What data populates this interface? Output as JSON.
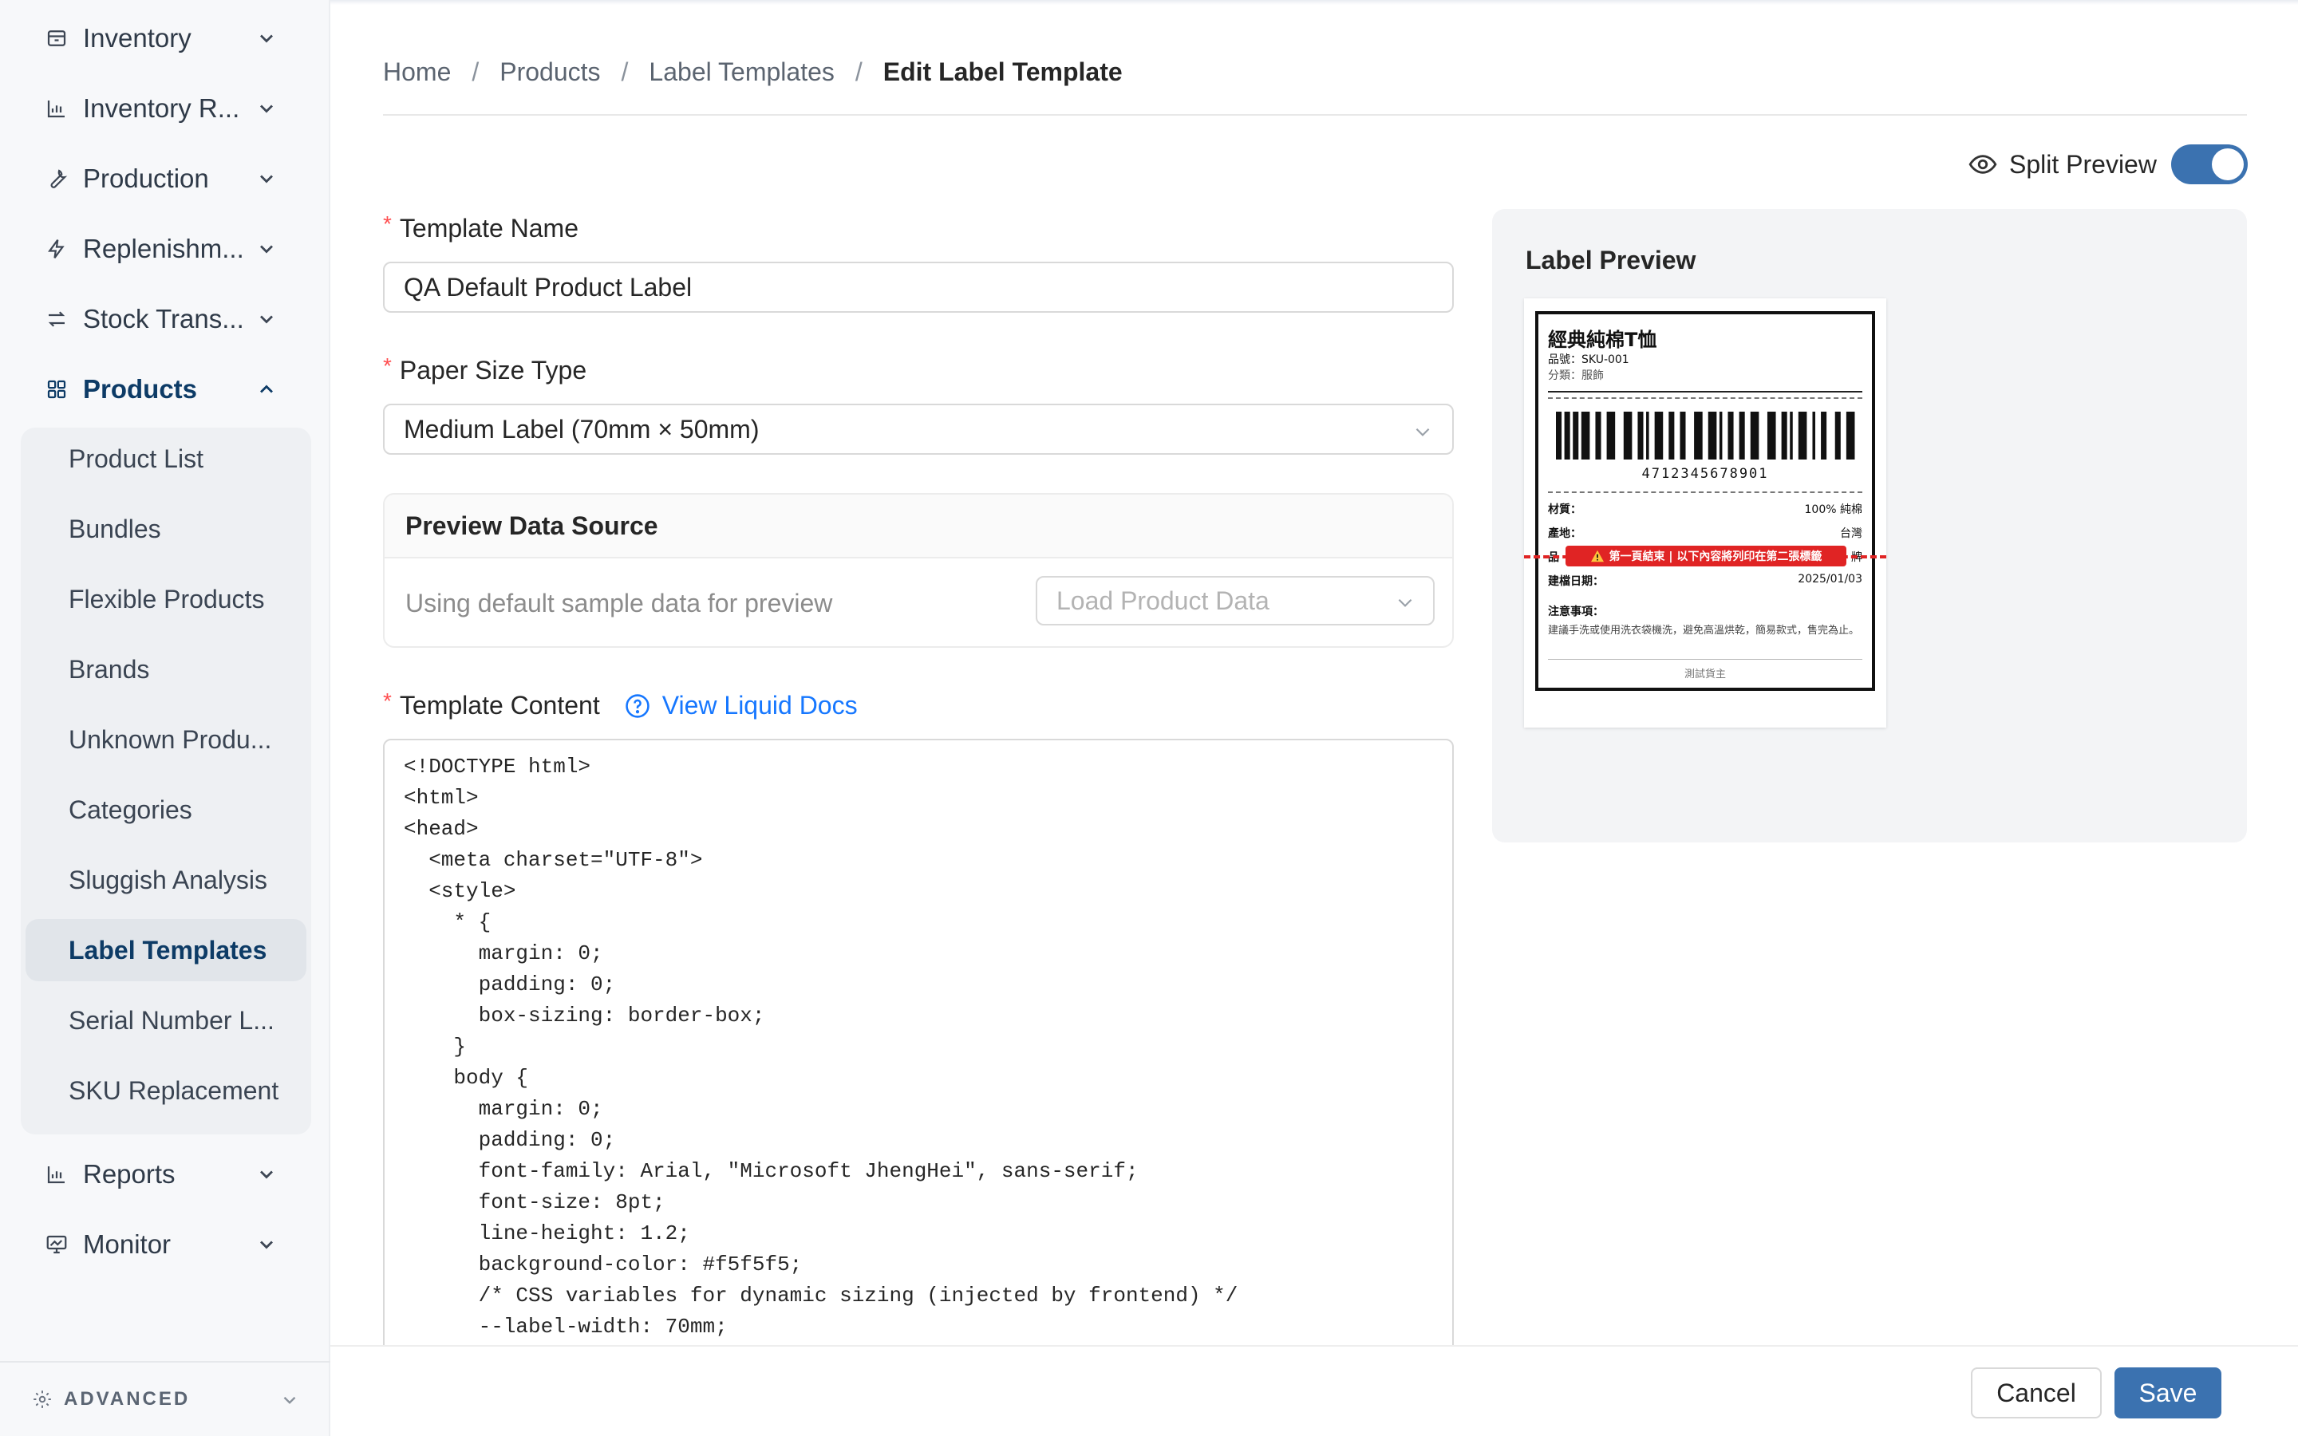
{
  "sidebar": {
    "groups": [
      {
        "label": "Inventory",
        "icon": "box-icon"
      },
      {
        "label": "Inventory R...",
        "icon": "bar-chart-icon"
      },
      {
        "label": "Production",
        "icon": "wrench-icon"
      },
      {
        "label": "Replenishm...",
        "icon": "bolt-icon"
      },
      {
        "label": "Stock Trans...",
        "icon": "transfer-icon"
      },
      {
        "label": "Products",
        "icon": "grid-icon"
      },
      {
        "label": "Reports",
        "icon": "bar-chart-icon"
      },
      {
        "label": "Monitor",
        "icon": "monitor-icon"
      }
    ],
    "product_items": [
      "Product List",
      "Bundles",
      "Flexible Products",
      "Brands",
      "Unknown Produ...",
      "Categories",
      "Sluggish Analysis",
      "Label Templates",
      "Serial Number L...",
      "SKU Replacement"
    ],
    "active_item": "Label Templates",
    "advanced_label": "ADVANCED"
  },
  "breadcrumb": {
    "items": [
      "Home",
      "Products",
      "Label Templates"
    ],
    "current": "Edit Label Template",
    "separator": "/"
  },
  "split_preview": {
    "label": "Split Preview",
    "enabled": true
  },
  "form": {
    "template_name": {
      "label": "Template Name",
      "value": "QA Default Product Label"
    },
    "paper_size": {
      "label": "Paper Size Type",
      "value": "Medium Label (70mm × 50mm)"
    },
    "preview_source": {
      "title": "Preview Data Source",
      "note": "Using default sample data for preview",
      "select_placeholder": "Load Product Data"
    },
    "template_content": {
      "label": "Template Content",
      "docs_link": "View Liquid Docs",
      "code": "<!DOCTYPE html>\n<html>\n<head>\n  <meta charset=\"UTF-8\">\n  <style>\n    * {\n      margin: 0;\n      padding: 0;\n      box-sizing: border-box;\n    }\n    body {\n      margin: 0;\n      padding: 0;\n      font-family: Arial, \"Microsoft JhengHei\", sans-serif;\n      font-size: 8pt;\n      line-height: 1.2;\n      background-color: #f5f5f5;\n      /* CSS variables for dynamic sizing (injected by frontend) */\n      --label-width: 70mm;"
    }
  },
  "preview": {
    "title": "Label Preview",
    "label": {
      "product_name": "經典純棉T恤",
      "sku": "品號：SKU-001",
      "category": "分類：服飾",
      "barcode": "4712345678901",
      "rows": [
        {
          "k": "材質：",
          "v": "100% 純棉"
        },
        {
          "k": "產地：",
          "v": "台灣"
        },
        {
          "k": "品",
          "v": "牌"
        },
        {
          "k": "建檔日期：",
          "v": "2025/01/03"
        }
      ],
      "notes_title": "注意事項：",
      "notes": "建議手洗或使用洗衣袋機洗，避免高溫烘乾，簡易款式，售完為止。",
      "footer": "測試貨主",
      "page_break": "第一頁結束 | 以下內容將列印在第二張標籤"
    }
  },
  "footer": {
    "cancel": "Cancel",
    "save": "Save"
  },
  "colors": {
    "primary": "#3b72b0",
    "active_nav": "#0d3b66",
    "required": "#ff4d4f",
    "link": "#1677ff",
    "page_break": "#e02424"
  }
}
